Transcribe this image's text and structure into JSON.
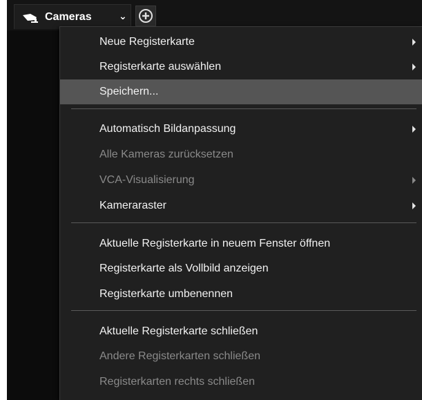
{
  "tab_bar": {
    "active_tab_label": "Cameras",
    "icons": {
      "camera": "camera-icon",
      "dropdown": "chevron-down-icon",
      "add_tab": "add-tab-icon",
      "submenu": "submenu-arrow-icon"
    }
  },
  "context_menu": {
    "items": [
      {
        "label": "Neue Registerkarte",
        "enabled": true,
        "submenu": true
      },
      {
        "label": "Registerkarte auswählen",
        "enabled": true,
        "submenu": true
      },
      {
        "label": "Speichern...",
        "enabled": true,
        "highlighted": true
      },
      {
        "label": "Automatisch Bildanpassung",
        "enabled": true,
        "submenu": true
      },
      {
        "label": "Alle Kameras zurücksetzen",
        "enabled": false
      },
      {
        "label": "VCA-Visualisierung",
        "enabled": false,
        "submenu": true
      },
      {
        "label": "Kameraraster",
        "enabled": true,
        "submenu": true
      },
      {
        "label": "Aktuelle Registerkarte in neuem Fenster öffnen",
        "enabled": true
      },
      {
        "label": "Registerkarte als Vollbild anzeigen",
        "enabled": true
      },
      {
        "label": "Registerkarte umbenennen",
        "enabled": true
      },
      {
        "label": "Aktuelle Registerkarte schließen",
        "enabled": true
      },
      {
        "label": "Andere Registerkarten schließen",
        "enabled": false
      },
      {
        "label": "Registerkarten rechts schließen",
        "enabled": false
      }
    ]
  },
  "colors": {
    "background": "#0c0c0c",
    "menu_background": "#202020",
    "highlight": "#555555",
    "text": "#f2f2f2",
    "disabled_text": "#8a8a8a"
  }
}
